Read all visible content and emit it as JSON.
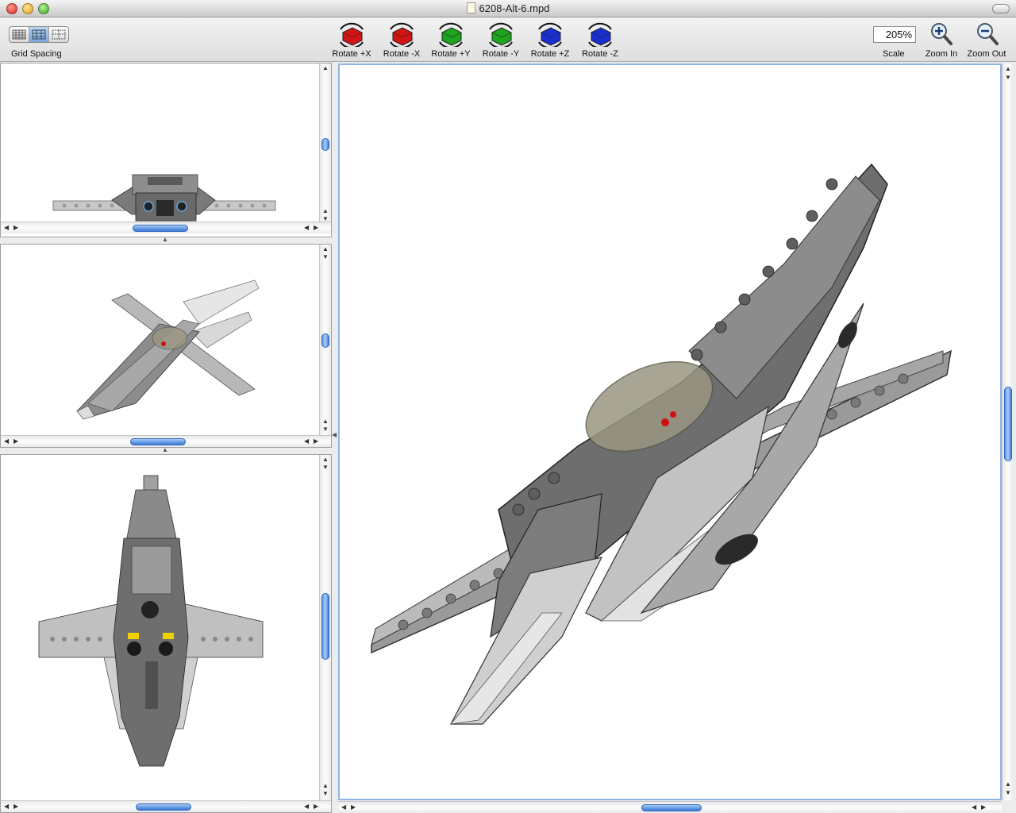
{
  "window": {
    "title": "6208-Alt-6.mpd"
  },
  "toolbar": {
    "grid_spacing_label": "Grid Spacing",
    "rotate_buttons": [
      {
        "label": "Rotate +X",
        "color": "#d21414",
        "icon": "rotate-x-plus-icon"
      },
      {
        "label": "Rotate -X",
        "color": "#d21414",
        "icon": "rotate-x-minus-icon"
      },
      {
        "label": "Rotate +Y",
        "color": "#1ea41e",
        "icon": "rotate-y-plus-icon"
      },
      {
        "label": "Rotate -Y",
        "color": "#1ea41e",
        "icon": "rotate-y-minus-icon"
      },
      {
        "label": "Rotate +Z",
        "color": "#1a2ed0",
        "icon": "rotate-z-plus-icon"
      },
      {
        "label": "Rotate -Z",
        "color": "#1a2ed0",
        "icon": "rotate-z-minus-icon"
      }
    ],
    "scale_value": "205%",
    "scale_label": "Scale",
    "zoom_in_label": "Zoom In",
    "zoom_out_label": "Zoom Out"
  },
  "viewports": {
    "front_view": {
      "icon": "spaceship-front-view"
    },
    "perspective_small": {
      "icon": "spaceship-perspective-view"
    },
    "top_view": {
      "icon": "spaceship-top-view"
    },
    "main_view": {
      "icon": "spaceship-3d-main-view"
    }
  },
  "colors": {
    "lego_gray": "#8c8c8c",
    "lego_light_gray": "#c4c4c4",
    "lego_dark_gray": "#5a5a5a",
    "canopy": "#9a9682",
    "accent_yellow": "#f0d000",
    "accent_red": "#d01010",
    "selection_blue": "#7ea8dc"
  }
}
